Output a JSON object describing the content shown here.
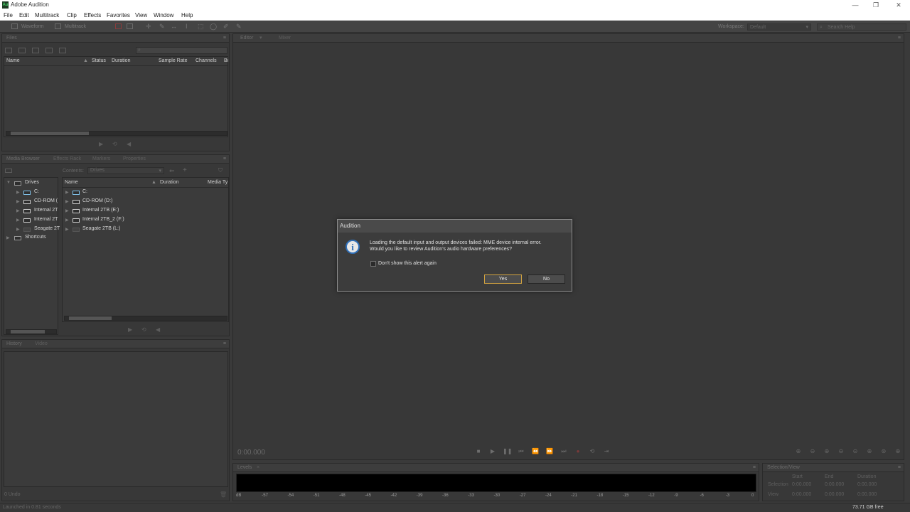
{
  "window": {
    "title": "Adobe Audition",
    "logo": "Au",
    "controls": [
      "—",
      "❐",
      "✕"
    ]
  },
  "menu": [
    "File",
    "Edit",
    "Multitrack",
    "Clip",
    "Effects",
    "Favorites",
    "View",
    "Window",
    "Help"
  ],
  "toolbar": {
    "waveform_label": "Waveform",
    "multitrack_label": "Multitrack",
    "workspace_label": "Workspace:",
    "workspace_value": "Default",
    "search_placeholder": "Search Help"
  },
  "files_panel": {
    "tab": "Files",
    "columns": [
      "Name",
      "Status",
      "Duration",
      "Sample Rate",
      "Channels",
      "Bi"
    ]
  },
  "media_panel": {
    "tabs": [
      "Media Browser",
      "Effects Rack",
      "Markers",
      "Properties"
    ],
    "contents_label": "Contents:",
    "contents_value": "Drives",
    "tree": [
      {
        "label": "Drives",
        "expanded": true
      },
      {
        "label": "C:"
      },
      {
        "label": "CD-ROM ("
      },
      {
        "label": "Internal 2T"
      },
      {
        "label": "Internal 2T"
      },
      {
        "label": "Seagate 2T"
      },
      {
        "label": "Shortcuts"
      }
    ],
    "columns": [
      "Name",
      "Duration",
      "Media Ty"
    ],
    "items": [
      "C:",
      "CD-ROM (D:)",
      "Internal 2TB (E:)",
      "Internal 2TB_2 (F:)",
      "Seagate 2TB (L:)"
    ]
  },
  "history_panel": {
    "tabs": [
      "History",
      "Video"
    ],
    "undo_count": "0 Undo"
  },
  "editor_panel": {
    "tabs": [
      "Editor",
      "Mixer"
    ],
    "time": "0:00.000"
  },
  "levels_panel": {
    "tab": "Levels",
    "ticks": [
      "dB",
      "-57",
      "-54",
      "-51",
      "-48",
      "-45",
      "-42",
      "-39",
      "-36",
      "-33",
      "-30",
      "-27",
      "-24",
      "-21",
      "-18",
      "-15",
      "-12",
      "-9",
      "-6",
      "-3",
      "0"
    ]
  },
  "selection_panel": {
    "tab": "Selection/View",
    "headers": [
      "Start",
      "End",
      "Duration"
    ],
    "rows": [
      {
        "label": "Selection",
        "start": "0:00.000",
        "end": "0:00.000",
        "duration": "0:00.000"
      },
      {
        "label": "View",
        "start": "0:00.000",
        "end": "0:00.000",
        "duration": "0:00.000"
      }
    ]
  },
  "status": {
    "left": "Launched in 0.81 seconds",
    "right": "73.71 GB free"
  },
  "dialog": {
    "title": "Audition",
    "message_line1": "Loading the default input and output devices failed: MME device internal error.",
    "message_line2": "Would you like to review Audition's audio hardware preferences?",
    "checkbox_label": "Don't show this alert again",
    "yes": "Yes",
    "no": "No"
  },
  "colors": {
    "background": "#3a3a3a",
    "panel": "#383838",
    "dialog_default_border": "#d1a240",
    "info_icon": "#2f6fb8"
  }
}
